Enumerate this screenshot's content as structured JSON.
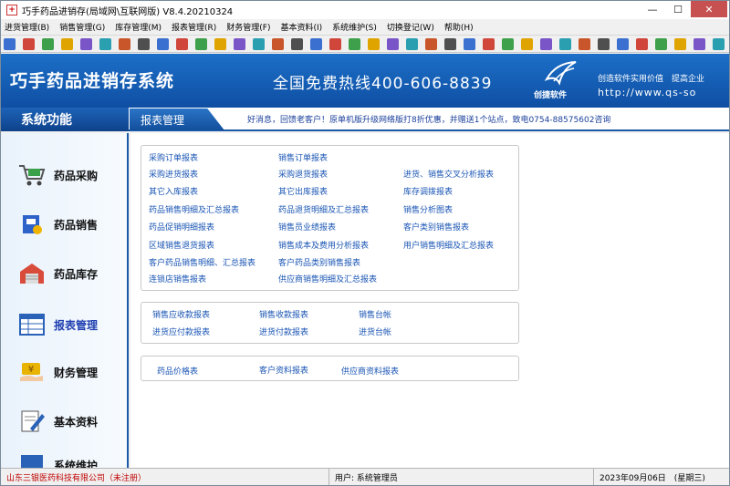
{
  "window": {
    "title": "巧手药品进销存(局域网\\互联网版) V8.4.20210324",
    "minimize": "—",
    "maximize": "☐",
    "close": "✕"
  },
  "menu": [
    "进货管理(B)",
    "销售管理(G)",
    "库存管理(M)",
    "报表管理(R)",
    "财务管理(F)",
    "基本资料(I)",
    "系统维护(S)",
    "切换登记(W)",
    "帮助(H)"
  ],
  "toolbar_icons": [
    "toolbar-icon-1",
    "toolbar-icon-2",
    "toolbar-icon-3",
    "toolbar-icon-4",
    "toolbar-icon-5",
    "toolbar-icon-6",
    "toolbar-icon-7",
    "toolbar-icon-8",
    "toolbar-icon-9",
    "toolbar-icon-10",
    "toolbar-icon-11",
    "toolbar-icon-12",
    "toolbar-icon-13",
    "toolbar-icon-14",
    "toolbar-icon-15",
    "toolbar-icon-16",
    "toolbar-icon-17",
    "toolbar-icon-18",
    "toolbar-icon-19",
    "toolbar-icon-20",
    "toolbar-icon-21",
    "toolbar-icon-22",
    "toolbar-icon-23",
    "toolbar-icon-24",
    "toolbar-icon-25",
    "toolbar-icon-26",
    "toolbar-icon-27",
    "toolbar-icon-28",
    "toolbar-icon-29",
    "toolbar-icon-30",
    "toolbar-icon-31",
    "toolbar-icon-32",
    "toolbar-icon-33",
    "toolbar-icon-34",
    "toolbar-icon-35",
    "toolbar-icon-36",
    "toolbar-icon-37",
    "toolbar-icon-38"
  ],
  "banner": {
    "brand": "巧手药品进销存系统",
    "hotline": "全国免费热线400-606-8839",
    "logo_text": "创捷软件",
    "slogan": "创造软件实用价值　提高企业",
    "url": "http://www.qs-so"
  },
  "subbar": {
    "system_title": "系统功能",
    "active_tab": "报表管理",
    "news": "好消息，回馈老客户！原单机版升级网络版打8折优惠，并赠送1个站点，致电0754-88575602咨询"
  },
  "sidebar": [
    {
      "label": "药品采购",
      "icon": "cart-icon"
    },
    {
      "label": "药品销售",
      "icon": "pharmacy-box-icon"
    },
    {
      "label": "药品库存",
      "icon": "warehouse-icon"
    },
    {
      "label": "报表管理",
      "icon": "report-table-icon"
    },
    {
      "label": "财务管理",
      "icon": "money-hand-icon"
    },
    {
      "label": "基本资料",
      "icon": "notepad-pencil-icon"
    },
    {
      "label": "系统维护",
      "icon": "monitor-icon"
    }
  ],
  "panels": {
    "main": [
      [
        "采购订单报表",
        "销售订单报表",
        ""
      ],
      [
        "采购进货报表",
        "采购退货报表",
        "进货、销售交叉分析报表"
      ],
      [
        "其它入库报表",
        "其它出库报表",
        "库存调拨报表"
      ],
      [
        "药品销售明细及汇总报表",
        "药品退货明细及汇总报表",
        "销售分析图表"
      ],
      [
        "药品促销明细报表",
        "销售员业绩报表",
        "客户类别销售报表"
      ],
      [
        "区域销售退货报表",
        "销售成本及费用分析报表",
        "用户销售明细及汇总报表"
      ],
      [
        "客户药品销售明细、汇总报表",
        "客户药品类别销售报表",
        ""
      ],
      [
        "连锁店销售报表",
        "供应商销售明细及汇总报表",
        ""
      ]
    ],
    "finance": [
      [
        "销售应收款报表",
        "销售收款报表",
        "销售台帐"
      ],
      [
        "进货应付款报表",
        "进货付款报表",
        "进货台帐"
      ]
    ],
    "basic": [
      [
        "药品价格表",
        "客户资料报表",
        "供应商资料报表"
      ]
    ]
  },
  "status": {
    "company": "山东三银医药科技有限公司（未注册）",
    "user": "用户: 系统管理员",
    "date": "2023年09月06日　(星期三)"
  },
  "colors": {
    "banner_blue": "#1565c0",
    "link_blue": "#1a55b4",
    "news_blue": "#1a3f9a",
    "status_red": "#c00000"
  }
}
